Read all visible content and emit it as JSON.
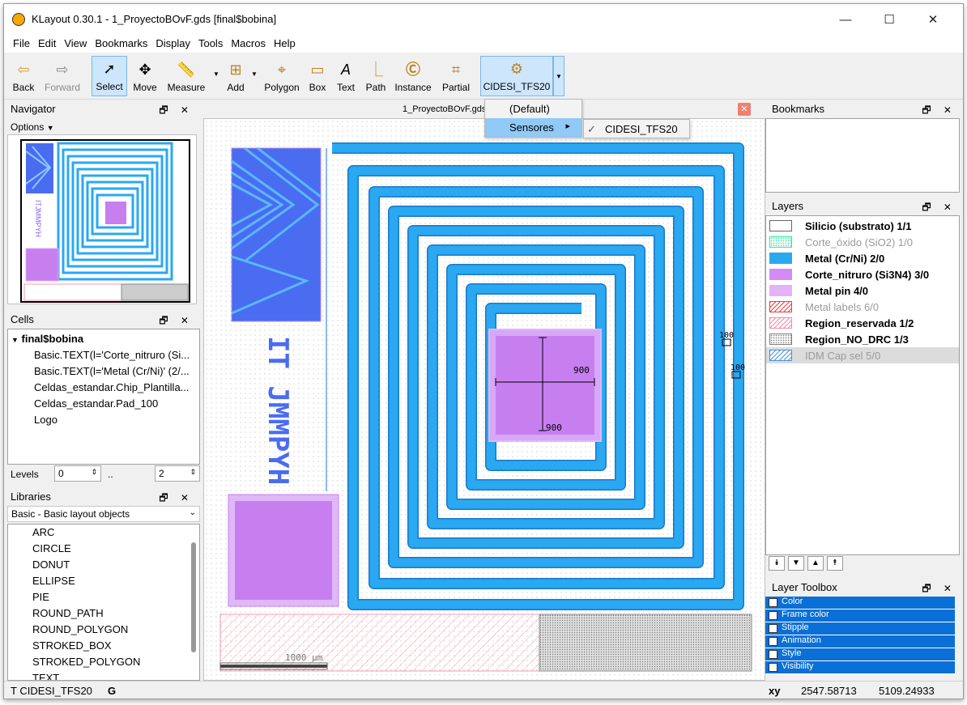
{
  "window": {
    "title": "KLayout 0.30.1 - 1_ProyectoBOvF.gds [final$bobina]",
    "minimize": "—",
    "maximize": "☐",
    "close": "✕"
  },
  "menu": [
    "File",
    "Edit",
    "View",
    "Bookmarks",
    "Display",
    "Tools",
    "Macros",
    "Help"
  ],
  "toolbar": {
    "back": "Back",
    "forward": "Forward",
    "select": "Select",
    "move": "Move",
    "measure": "Measure",
    "add": "Add",
    "polygon": "Polygon",
    "box": "Box",
    "text": "Text",
    "path": "Path",
    "instance": "Instance",
    "partial": "Partial",
    "tech": "CIDESI_TFS20"
  },
  "tech_menu": {
    "default": "(Default)",
    "sensores": "Sensores",
    "sub_item": "CIDESI_TFS20",
    "check": "✓",
    "submenu_arrow": "▸"
  },
  "navigator": {
    "title": "Navigator",
    "options": "Options",
    "options_arrow": "▼"
  },
  "cells": {
    "title": "Cells",
    "root": "final$bobina",
    "toggle": "▼",
    "items": [
      "Basic.TEXT(l='Corte_nitruro (Si...",
      "Basic.TEXT(l='Metal (Cr/Ni)' (2/...",
      "Celdas_estandar.Chip_Plantilla...",
      "Celdas_estandar.Pad_100",
      "Logo"
    ],
    "levels_label": "Levels",
    "level_min": "0",
    "level_sep": "..",
    "level_max": "2"
  },
  "libraries": {
    "title": "Libraries",
    "selected": "Basic - Basic layout objects",
    "items": [
      "ARC",
      "CIRCLE",
      "DONUT",
      "ELLIPSE",
      "PIE",
      "ROUND_PATH",
      "ROUND_POLYGON",
      "STROKED_BOX",
      "STROKED_POLYGON",
      "TEXT"
    ]
  },
  "panel_controls": "🗗 ✕",
  "doc_tab": {
    "title": "1_ProyectoBOvF.gds"
  },
  "bookmarks": {
    "title": "Bookmarks"
  },
  "layers": {
    "title": "Layers",
    "items": [
      {
        "label": "Silicio (substrato) 1/1",
        "bold": true,
        "dim": false,
        "color": "#ffffff",
        "pattern": "solid"
      },
      {
        "label": "Corte_óxido (SiO2) 1/0",
        "bold": false,
        "dim": true,
        "color": "#38e6a0",
        "pattern": "dots"
      },
      {
        "label": "Metal (Cr/Ni) 2/0",
        "bold": true,
        "dim": false,
        "color": "#29a8f0",
        "pattern": "solid"
      },
      {
        "label": "Corte_nitruro (Si3N4) 3/0",
        "bold": true,
        "dim": false,
        "color": "#d48bf5",
        "pattern": "solid"
      },
      {
        "label": "Metal pin 4/0",
        "bold": true,
        "dim": false,
        "color": "#e4b2f7",
        "pattern": "solid"
      },
      {
        "label": "Metal labels 6/0",
        "bold": false,
        "dim": true,
        "color": "#e64040",
        "pattern": "hatch"
      },
      {
        "label": "Region_reservada 1/2",
        "bold": true,
        "dim": false,
        "color": "#f58aa8",
        "pattern": "hatch"
      },
      {
        "label": "Region_NO_DRC 1/3",
        "bold": true,
        "dim": false,
        "color": "#808080",
        "pattern": "dots"
      },
      {
        "label": "IDM Cap sel 5/0",
        "bold": false,
        "dim": true,
        "color": "#4a90e0",
        "pattern": "hatch"
      }
    ],
    "nav_buttons": [
      "⯯",
      "▼",
      "▲",
      "⯭"
    ]
  },
  "layer_toolbox": {
    "title": "Layer Toolbox",
    "items": [
      "Color",
      "Frame color",
      "Stipple",
      "Animation",
      "Style",
      "Visibility"
    ]
  },
  "canvas": {
    "logo_text": "IT JMMPYH",
    "ruler_100a": "100",
    "ruler_100b": "100",
    "ruler_900a": "900",
    "ruler_900b": "900",
    "scale": "1000 μm",
    "close_icon": "✕"
  },
  "status": {
    "tech": "T CIDESI_TFS20",
    "grid": "G",
    "xy_label": "xy",
    "x": "2547.58713",
    "y": "5109.24933"
  },
  "colors": {
    "metal": "#2aa8f2",
    "metal_edge": "#1a78c8",
    "pin": "#c77ff0",
    "logo": "#4a6cf0",
    "hatch": "#f59bb0",
    "nodrc": "#888888",
    "accent": "#0a6fd6"
  }
}
